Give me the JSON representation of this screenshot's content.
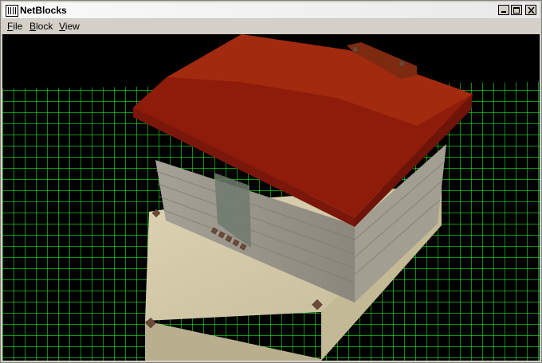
{
  "window": {
    "title": "NetBlocks"
  },
  "menu": [
    {
      "label": "File",
      "mnemonic": "F",
      "rest": "ile"
    },
    {
      "label": "Block",
      "mnemonic": "B",
      "rest": "lock"
    },
    {
      "label": "View",
      "mnemonic": "V",
      "rest": "iew"
    }
  ],
  "scene": {
    "background": "#000000",
    "grid_color": "#1ee61e",
    "roof_color": "#8f1c0a",
    "wall_color": "#9a958a",
    "base_color": "#d2c7a6"
  }
}
